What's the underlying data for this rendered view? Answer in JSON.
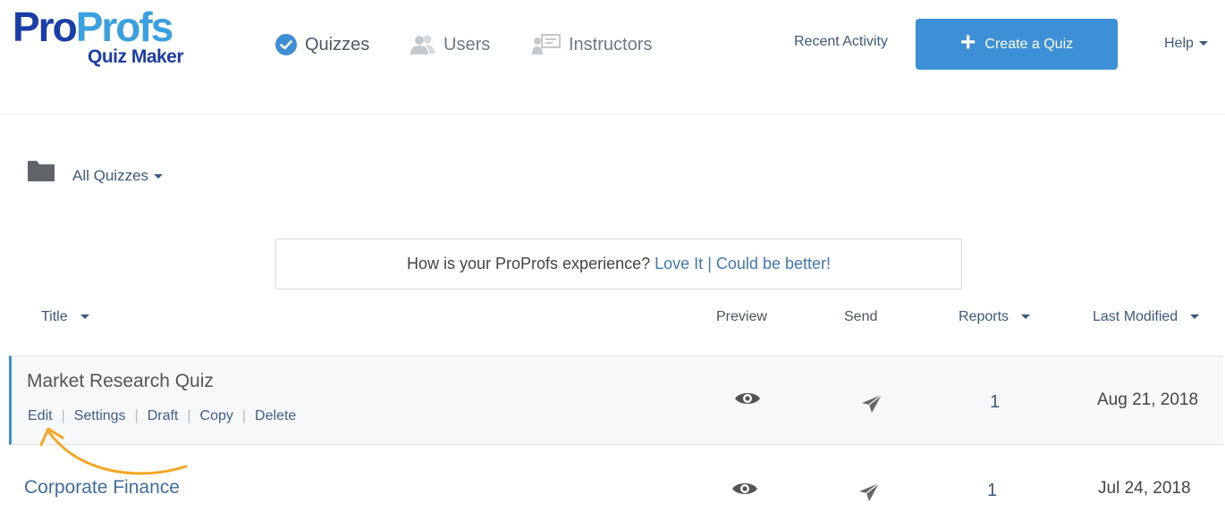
{
  "header": {
    "logo_part1": "Pro",
    "logo_part2": "Profs",
    "logo_sub": "Quiz Maker",
    "nav": {
      "quizzes": "Quizzes",
      "users": "Users",
      "instructors": "Instructors"
    },
    "recent_activity": "Recent Activity",
    "create_button": "Create a Quiz",
    "help": "Help"
  },
  "folder": {
    "label": "All Quizzes"
  },
  "feedback": {
    "question": "How is your ProProfs experience?",
    "love_it": "Love It",
    "separator": "|",
    "could_be_better": "Could be better!"
  },
  "table": {
    "columns": {
      "title": "Title",
      "preview": "Preview",
      "send": "Send",
      "reports": "Reports",
      "last_modified": "Last Modified"
    },
    "rows": [
      {
        "title": "Market Research Quiz",
        "actions": [
          "Edit",
          "Settings",
          "Draft",
          "Copy",
          "Delete"
        ],
        "reports": "1",
        "last_modified": "Aug 21, 2018"
      },
      {
        "title": "Corporate Finance",
        "reports": "1",
        "last_modified": "Jul 24, 2018"
      }
    ]
  },
  "colors": {
    "primary_blue": "#3d8fd6",
    "logo_dark": "#1a3ea8",
    "logo_light": "#3aa0e0",
    "annotation_arrow": "#f5a623"
  }
}
